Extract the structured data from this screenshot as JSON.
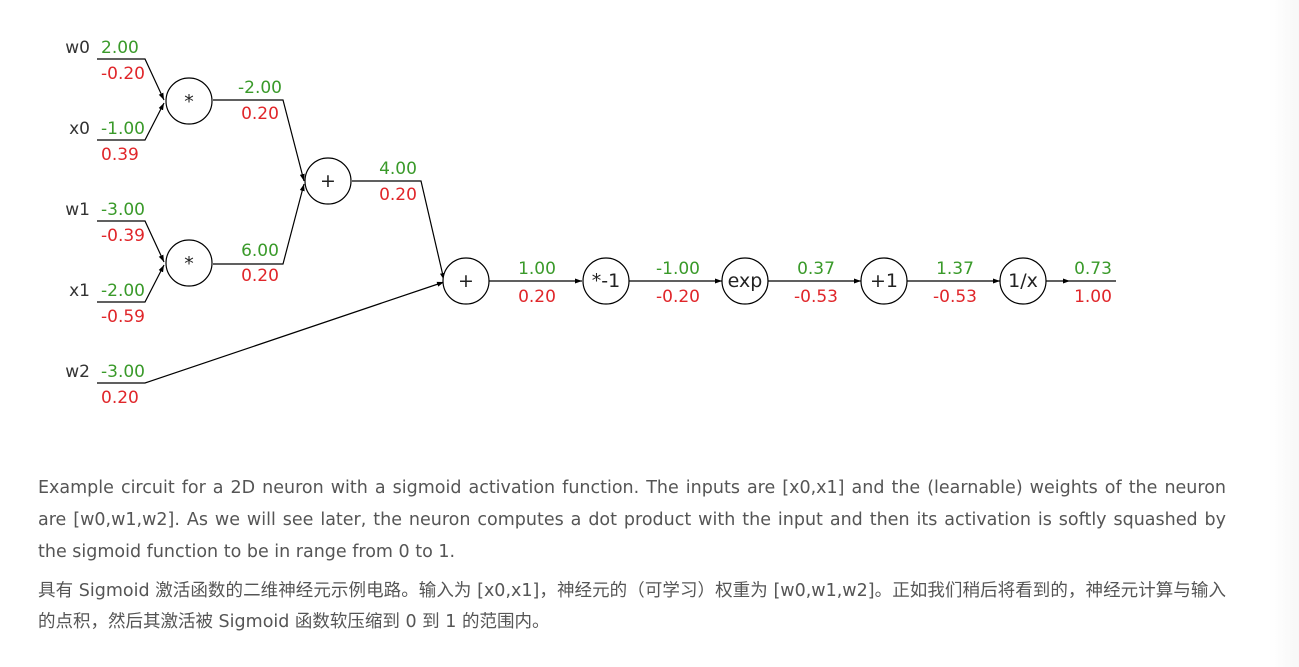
{
  "diagram": {
    "inputs": [
      {
        "name": "w0",
        "forward": "2.00",
        "grad": "-0.20"
      },
      {
        "name": "x0",
        "forward": "-1.00",
        "grad": "0.39"
      },
      {
        "name": "w1",
        "forward": "-3.00",
        "grad": "-0.39"
      },
      {
        "name": "x1",
        "forward": "-2.00",
        "grad": "-0.59"
      },
      {
        "name": "w2",
        "forward": "-3.00",
        "grad": "0.20"
      }
    ],
    "gates": {
      "mul0": {
        "op": "*",
        "out_forward": "-2.00",
        "out_grad": "0.20"
      },
      "mul1": {
        "op": "*",
        "out_forward": "6.00",
        "out_grad": "0.20"
      },
      "add0": {
        "op": "+",
        "out_forward": "4.00",
        "out_grad": "0.20"
      },
      "add1": {
        "op": "+",
        "out_forward": "1.00",
        "out_grad": "0.20"
      },
      "neg": {
        "op": "*-1",
        "out_forward": "-1.00",
        "out_grad": "-0.20"
      },
      "exp": {
        "op": "exp",
        "out_forward": "0.37",
        "out_grad": "-0.53"
      },
      "plus1": {
        "op": "+1",
        "out_forward": "1.37",
        "out_grad": "-0.53"
      },
      "inv": {
        "op": "1/x",
        "out_forward": "0.73",
        "out_grad": "1.00"
      }
    },
    "colors": {
      "forward": "#3a9a2a",
      "gradient": "#e0262a"
    }
  },
  "caption_en": "Example circuit for a 2D neuron with a sigmoid activation function. The inputs are [x0,x1] and the (learnable) weights of the neuron are [w0,w1,w2]. As we will see later, the neuron computes a dot product with the input and then its activation is softly squashed by the sigmoid function to be in range from 0 to 1.",
  "caption_zh": "具有 Sigmoid 激活函数的二维神经元示例电路。输入为 [x0,x1]，神经元的（可学习）权重为 [w0,w1,w2]。正如我们稍后将看到的，神经元计算与输入的点积，然后其激活被 Sigmoid 函数软压缩到 0 到 1 的范围内。"
}
